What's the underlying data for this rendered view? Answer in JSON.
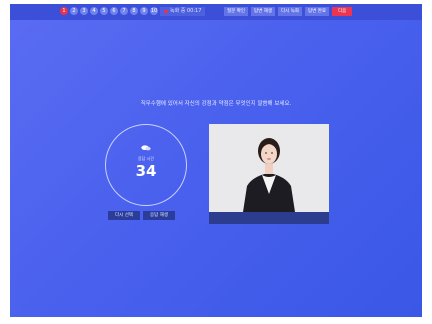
{
  "question_numbers": [
    "1",
    "2",
    "3",
    "4",
    "5",
    "6",
    "7",
    "8",
    "9",
    "10"
  ],
  "active_question_index": 0,
  "timer": "녹화 중 00:17",
  "toolbar": {
    "btn1": "질문 확인",
    "btn2": "답변 재생",
    "btn3": "다시 녹화",
    "btn4": "답변 완료",
    "next": "다음"
  },
  "prompt": "직무수행에 있어서 자신의 강점과 약점은 무엇인지 말씀해 보세요.",
  "countdown": {
    "label": "응답 시간",
    "value": "34"
  },
  "buttons": {
    "left": "다시 선택",
    "right": "응답 재생"
  },
  "colors": {
    "background": "#4a61ee",
    "accent": "#ec3552"
  },
  "icons": {
    "chat": "chat-bubble-icon"
  }
}
